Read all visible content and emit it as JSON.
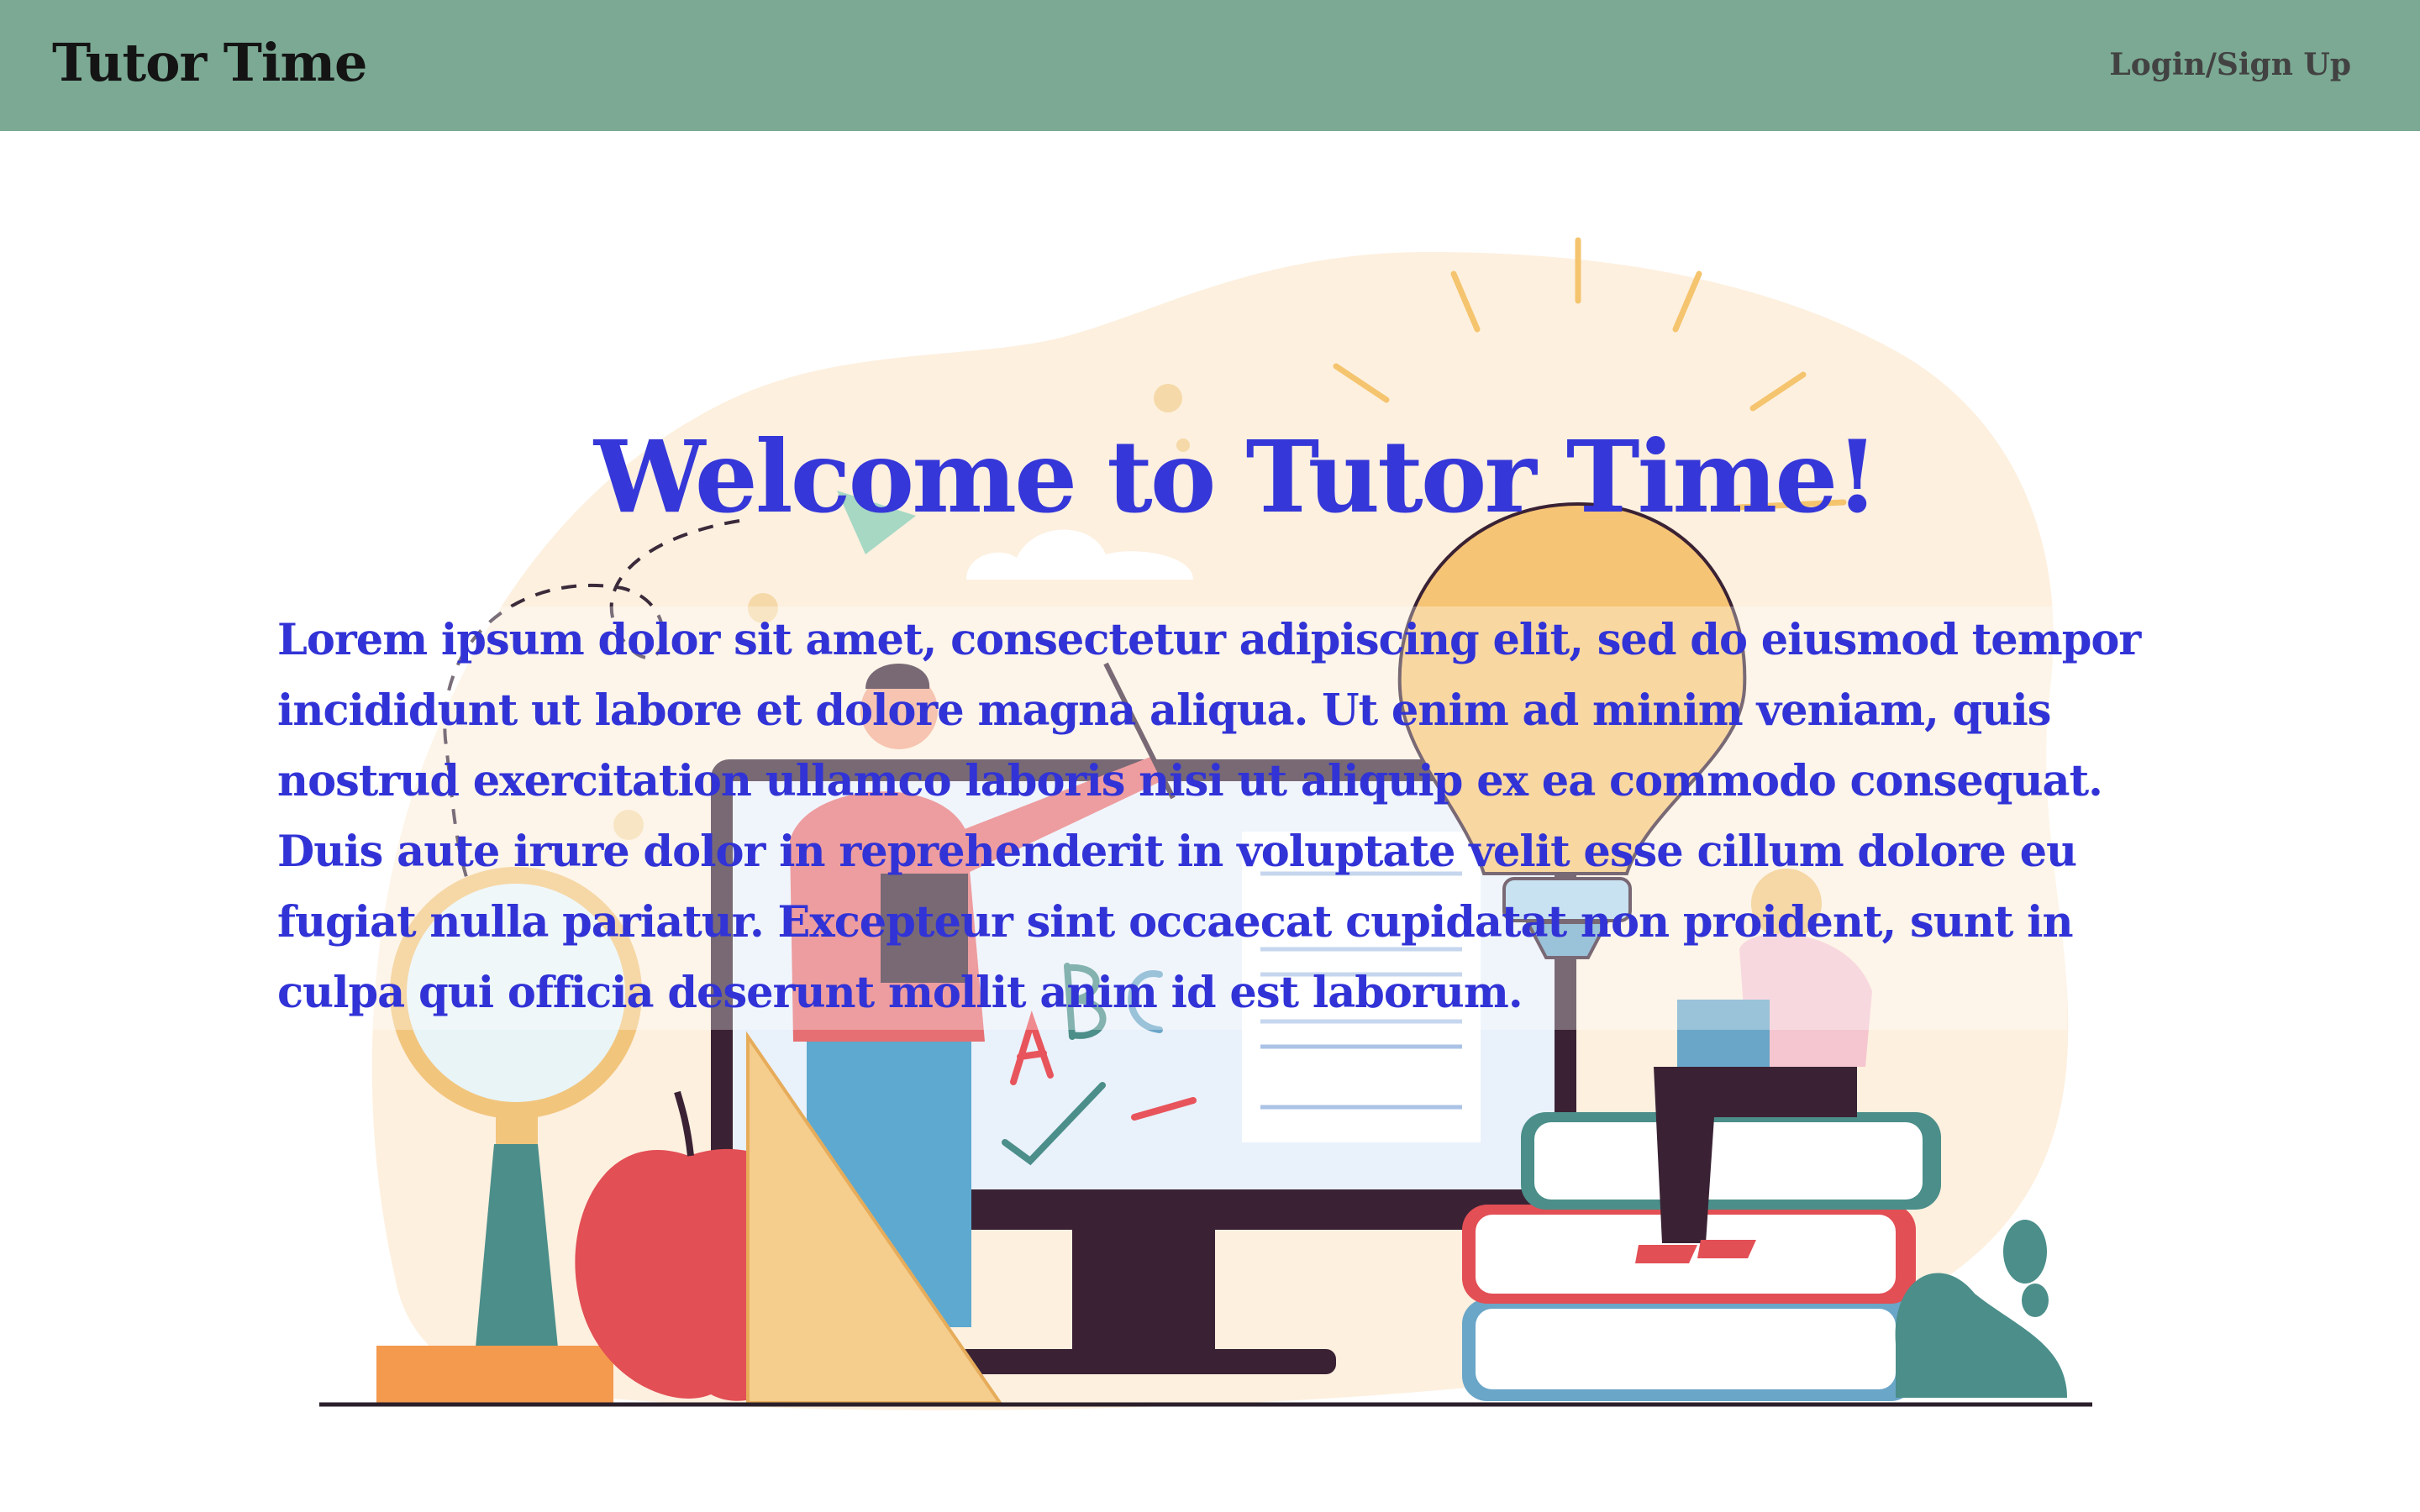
{
  "nav": {
    "brand": "Tutor Time",
    "login_label": "Login/Sign Up"
  },
  "hero": {
    "title": "Welcome to Tutor Time!",
    "body": "Lorem ipsum dolor sit amet, consectetur adipiscing elit, sed do eiusmod tempor incididunt ut labore et dolore magna aliqua. Ut enim ad minim veniam, quis nostrud exercitation ullamco laboris nisi ut aliquip ex ea commodo consequat. Duis aute irure dolor in reprehenderit in voluptate velit esse cillum dolore eu fugiat nulla pariatur. Excepteur sint occaecat cupidatat non proident, sunt in culpa qui officia deserunt mollit anim id est laborum.",
    "illustration": "education-illustration"
  },
  "colors": {
    "navbar": "#7ba993",
    "brand_text": "#141414",
    "login_text": "#424242",
    "hero_text": "#3537d8",
    "blob": "#fdf0df"
  }
}
